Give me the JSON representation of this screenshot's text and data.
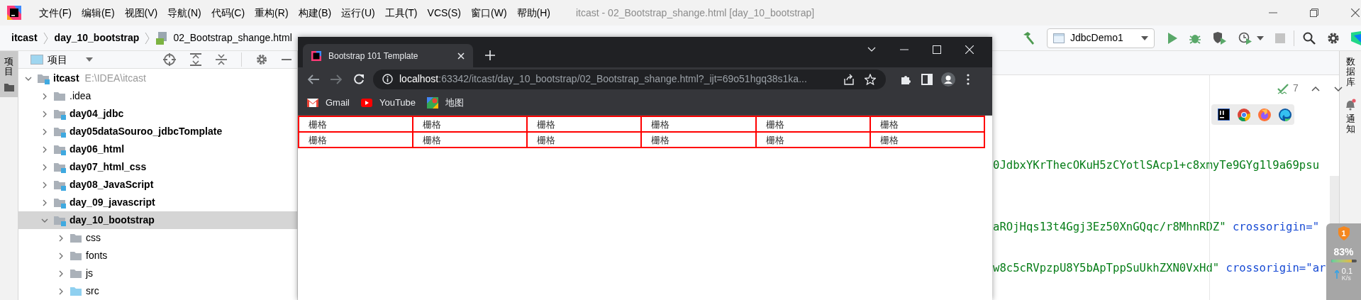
{
  "ide": {
    "menu": [
      "文件(F)",
      "编辑(E)",
      "视图(V)",
      "导航(N)",
      "代码(C)",
      "重构(R)",
      "构建(B)",
      "运行(U)",
      "工具(T)",
      "VCS(S)",
      "窗口(W)",
      "帮助(H)"
    ],
    "title": "itcast - 02_Bootstrap_shange.html [day_10_bootstrap]",
    "breadcrumbs": [
      {
        "label": "itcast",
        "kind": "folder"
      },
      {
        "label": "day_10_bootstrap",
        "kind": "folder"
      },
      {
        "label": "02_Bootstrap_shange.html",
        "kind": "file"
      }
    ],
    "run_config": "JdbcDemo1",
    "left_tools": [
      {
        "label": "项目",
        "selected": true
      }
    ],
    "project_panel": {
      "title": "项目",
      "tree": [
        {
          "label": "itcast",
          "path": "E:\\IDEA\\itcast",
          "kind": "module",
          "expanded": true,
          "selected": false,
          "children": [
            {
              "label": ".idea",
              "kind": "folder",
              "expanded": false,
              "selected": false
            },
            {
              "label": "day04_jdbc",
              "kind": "module",
              "expanded": false,
              "selected": false
            },
            {
              "label": "day05dataSouroo_jdbcTomplate",
              "kind": "module",
              "expanded": false,
              "selected": false
            },
            {
              "label": "day06_html",
              "kind": "module",
              "expanded": false,
              "selected": false
            },
            {
              "label": "day07_html_css",
              "kind": "module",
              "expanded": false,
              "selected": false
            },
            {
              "label": "day08_JavaScript",
              "kind": "module",
              "expanded": false,
              "selected": false
            },
            {
              "label": "day_09_javascript",
              "kind": "module",
              "expanded": false,
              "selected": false
            },
            {
              "label": "day_10_bootstrap",
              "kind": "module",
              "expanded": true,
              "selected": true,
              "children": [
                {
                  "label": "css",
                  "kind": "folder",
                  "expanded": false,
                  "selected": false
                },
                {
                  "label": "fonts",
                  "kind": "folder",
                  "expanded": false,
                  "selected": false
                },
                {
                  "label": "js",
                  "kind": "folder",
                  "expanded": false,
                  "selected": false
                },
                {
                  "label": "src",
                  "kind": "source",
                  "expanded": false,
                  "selected": false
                }
              ]
            }
          ]
        }
      ]
    },
    "inspections": {
      "count": "7"
    },
    "code_lines": [
      {
        "parts": [
          {
            "kind": "string",
            "text": "0JdbxYKrThecOKuH5zCYotlSAcp1+c8xmyTe9GYg1l9a69psu"
          }
        ]
      },
      {
        "parts": [
          {
            "kind": "string",
            "text": "aROjHqs13t4Ggj3Ez50XnGQqc/r8MhnRDZ\""
          },
          {
            "kind": "attr",
            "text": "crossorigin=\""
          }
        ]
      },
      {
        "parts": [
          {
            "kind": "string",
            "text": "w8c5cRVpzpU8Y5bApTppSuUkhZXN0VxHd\""
          },
          {
            "kind": "attr",
            "text": "crossorigin=\"ar"
          }
        ]
      }
    ],
    "right_tools": [
      {
        "label": "数据库",
        "kind": "database"
      },
      {
        "label": "通知",
        "kind": "notifications"
      }
    ]
  },
  "browser": {
    "tab": {
      "title": "Bootstrap 101 Template",
      "selected": true
    },
    "url": {
      "host": "localhost",
      "rest": ":63342/itcast/day_10_bootstrap/02_Bootstrap_shange.html?_ijt=69o51hgq38s1ka..."
    },
    "bookmarks": [
      {
        "label": "Gmail",
        "kind": "gmail"
      },
      {
        "label": "YouTube",
        "kind": "youtube"
      },
      {
        "label": "地图",
        "kind": "maps"
      }
    ],
    "grid_rows": [
      [
        "栅格",
        "栅格",
        "栅格",
        "栅格",
        "栅格",
        "栅格"
      ],
      [
        "栅格",
        "栅格",
        "栅格",
        "栅格",
        "栅格",
        "栅格"
      ]
    ]
  },
  "monitor": {
    "badge": "1",
    "cpu": "83%",
    "level": 0.83,
    "speed": "0.1",
    "unit": "K/s"
  }
}
